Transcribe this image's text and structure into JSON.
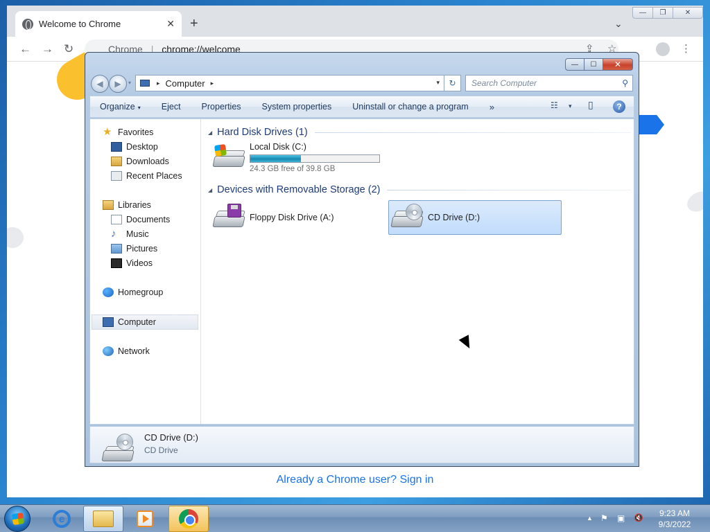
{
  "chrome": {
    "tab_title": "Welcome to Chrome",
    "tab_close": "✕",
    "new_tab": "+",
    "tab_search": "⌄",
    "win_minimize": "—",
    "win_restore": "❐",
    "win_close": "✕",
    "back": "←",
    "forward": "→",
    "reload": "↻",
    "omnibox_host": "Chrome",
    "omnibox_sep": "|",
    "omnibox_url": "chrome://welcome",
    "share": "⇪",
    "bookmark": "☆",
    "menu": "⋮",
    "signin_link": "Already a Chrome user? Sign in"
  },
  "explorer": {
    "caption": {
      "minimize": "—",
      "maximize": "☐",
      "close": "✕"
    },
    "nav": {
      "back": "◀",
      "forward": "▶",
      "dropdown": "▾"
    },
    "address": {
      "root_sep": "▸",
      "location": "Computer",
      "sep": "▸",
      "dropdown": "▾",
      "refresh": "↻"
    },
    "search": {
      "placeholder": "Search Computer",
      "icon": "⚲"
    },
    "commands": {
      "organize": "Organize",
      "organize_arrow": "▾",
      "eject": "Eject",
      "properties": "Properties",
      "system_properties": "System properties",
      "uninstall": "Uninstall or change a program",
      "more": "»",
      "views": "☷",
      "views_arrow": "▾",
      "preview_pane": "▯",
      "help": "?"
    },
    "nav_pane": {
      "favorites": "Favorites",
      "desktop": "Desktop",
      "downloads": "Downloads",
      "recent_places": "Recent Places",
      "libraries": "Libraries",
      "documents": "Documents",
      "music": "Music",
      "pictures": "Pictures",
      "videos": "Videos",
      "homegroup": "Homegroup",
      "computer": "Computer",
      "network": "Network",
      "star_glyph": "★",
      "note_glyph": "♪"
    },
    "groups": {
      "hard_disks": "Hard Disk Drives (1)",
      "removable": "Devices with Removable Storage (2)",
      "collapse_glyph": "◢"
    },
    "drives": {
      "local_disk": {
        "name": "Local Disk (C:)",
        "free": "24.3 GB free of 39.8 GB",
        "used_fraction": 0.39
      },
      "floppy": {
        "name": "Floppy Disk Drive (A:)"
      },
      "cd": {
        "name": "CD Drive (D:)"
      }
    },
    "details": {
      "name": "CD Drive (D:)",
      "type": "CD Drive"
    }
  },
  "taskbar": {
    "tray_arrow": "▲",
    "tray_flag": "⚑",
    "tray_network": "▣",
    "tray_volume": "🔇",
    "time": "9:23 AM",
    "date": "9/3/2022"
  },
  "colors": {
    "desktop_blue": "#2a84cf",
    "chrome_link": "#1a73e8",
    "explorer_frame": "#b4cbe4",
    "selection": "#c1dcfc",
    "group_header": "#1e3c78",
    "disk_bar": "#1d8fb8"
  },
  "icons": {
    "chrome_tab": "globe-icon",
    "explorer_drive_c": "hard-disk-windows-icon",
    "explorer_drive_a": "floppy-drive-icon",
    "explorer_drive_d": "cd-drive-icon",
    "taskbar": [
      "start-orb",
      "internet-explorer-icon",
      "windows-explorer-icon",
      "media-player-icon",
      "chrome-icon"
    ]
  }
}
